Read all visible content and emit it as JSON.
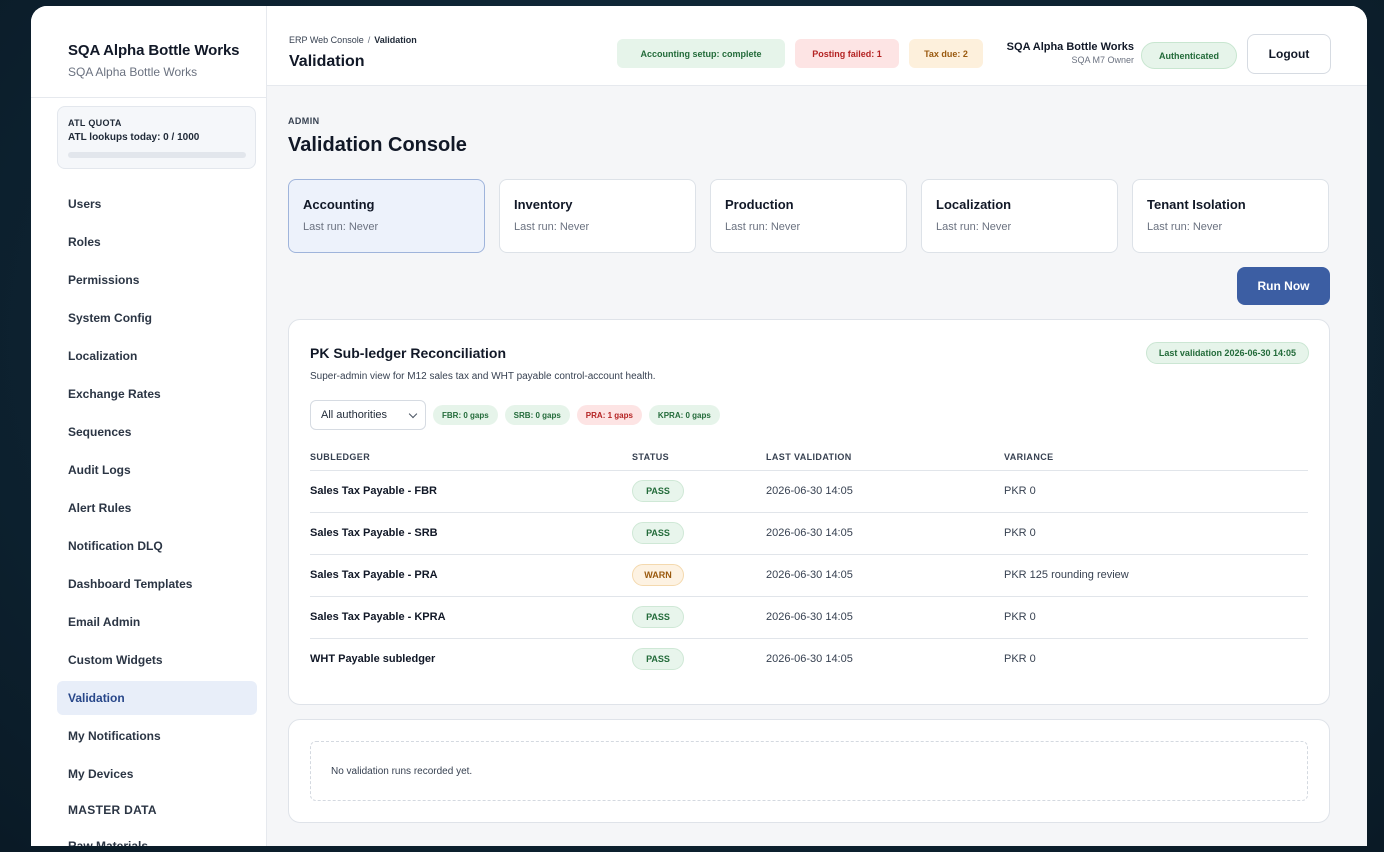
{
  "sidebar": {
    "brand_title": "SQA Alpha Bottle Works",
    "brand_sub": "SQA Alpha Bottle Works",
    "quota": {
      "label": "ATL QUOTA",
      "text": "ATL lookups today: 0 / 1000",
      "used": 0,
      "max": 1000
    },
    "items": [
      {
        "label": "Users"
      },
      {
        "label": "Roles"
      },
      {
        "label": "Permissions"
      },
      {
        "label": "System Config"
      },
      {
        "label": "Localization"
      },
      {
        "label": "Exchange Rates"
      },
      {
        "label": "Sequences"
      },
      {
        "label": "Audit Logs"
      },
      {
        "label": "Alert Rules"
      },
      {
        "label": "Notification DLQ"
      },
      {
        "label": "Dashboard Templates"
      },
      {
        "label": "Email Admin"
      },
      {
        "label": "Custom Widgets"
      },
      {
        "label": "Validation",
        "active": true
      },
      {
        "label": "My Notifications"
      },
      {
        "label": "My Devices"
      }
    ],
    "section": "MASTER DATA",
    "cut_item": "Raw Materials"
  },
  "header": {
    "crumb_root": "ERP Web Console",
    "crumb_sep": "/",
    "crumb_current": "Validation",
    "title": "Validation",
    "pills": {
      "accounting": "Accounting setup: complete",
      "posting": "Posting failed: 1",
      "tax": "Tax due: 2"
    },
    "org_name": "SQA Alpha Bottle Works",
    "org_role": "SQA M7 Owner",
    "auth": "Authenticated",
    "logout": "Logout"
  },
  "page": {
    "eyebrow": "ADMIN",
    "title": "Validation Console",
    "tabs": [
      {
        "name": "Accounting",
        "run": "Last run: Never",
        "active": true
      },
      {
        "name": "Inventory",
        "run": "Last run: Never"
      },
      {
        "name": "Production",
        "run": "Last run: Never"
      },
      {
        "name": "Localization",
        "run": "Last run: Never"
      },
      {
        "name": "Tenant Isolation",
        "run": "Last run: Never"
      }
    ],
    "run_button": "Run Now"
  },
  "recon": {
    "title": "PK Sub-ledger Reconciliation",
    "subtitle": "Super-admin view for M12 sales tax and WHT payable control-account health.",
    "last_validation": "Last validation 2026-06-30 14:05",
    "filter_value": "All authorities",
    "chips": [
      {
        "label": "FBR: 0 gaps",
        "tone": "green"
      },
      {
        "label": "SRB: 0 gaps",
        "tone": "green"
      },
      {
        "label": "PRA: 1 gaps",
        "tone": "red"
      },
      {
        "label": "KPRA: 0 gaps",
        "tone": "green"
      }
    ],
    "columns": [
      "SUBLEDGER",
      "STATUS",
      "LAST VALIDATION",
      "VARIANCE"
    ],
    "rows": [
      {
        "subledger": "Sales Tax Payable - FBR",
        "status": "PASS",
        "last": "2026-06-30 14:05",
        "variance": "PKR 0"
      },
      {
        "subledger": "Sales Tax Payable - SRB",
        "status": "PASS",
        "last": "2026-06-30 14:05",
        "variance": "PKR 0"
      },
      {
        "subledger": "Sales Tax Payable - PRA",
        "status": "WARN",
        "last": "2026-06-30 14:05",
        "variance": "PKR 125 rounding review"
      },
      {
        "subledger": "Sales Tax Payable - KPRA",
        "status": "PASS",
        "last": "2026-06-30 14:05",
        "variance": "PKR 0"
      },
      {
        "subledger": "WHT Payable subledger",
        "status": "PASS",
        "last": "2026-06-30 14:05",
        "variance": "PKR 0"
      }
    ]
  },
  "runs": {
    "empty": "No validation runs recorded yet."
  }
}
